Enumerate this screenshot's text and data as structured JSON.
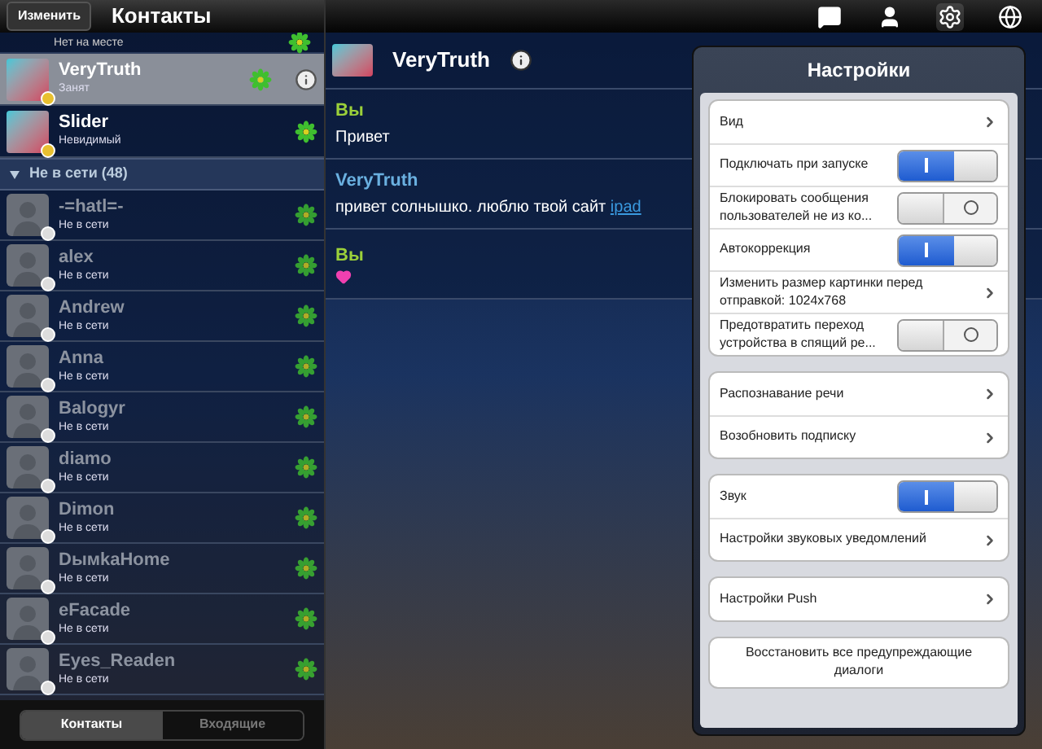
{
  "top_bar": {
    "edit_button": "Изменить",
    "title": "Контакты"
  },
  "contacts": [
    {
      "kind": "partial",
      "status": "Нет на месте"
    },
    {
      "kind": "contact",
      "name": "VeryTruth",
      "status": "Занят",
      "online": true,
      "selected": true
    },
    {
      "kind": "contact",
      "name": "Slider",
      "status": "Невидимый",
      "online": true,
      "selected": false
    },
    {
      "kind": "group",
      "label": "Не в сети (48)",
      "expanded": true
    },
    {
      "kind": "contact",
      "name": "-=hatl=-",
      "status": "Не в сети",
      "online": false,
      "selected": false
    },
    {
      "kind": "contact",
      "name": "alex",
      "status": "Не в сети",
      "online": false,
      "selected": false
    },
    {
      "kind": "contact",
      "name": "Andrew",
      "status": "Не в сети",
      "online": false,
      "selected": false
    },
    {
      "kind": "contact",
      "name": "Anna",
      "status": "Не в сети",
      "online": false,
      "selected": false
    },
    {
      "kind": "contact",
      "name": "Balogyr",
      "status": "Не в сети",
      "online": false,
      "selected": false
    },
    {
      "kind": "contact",
      "name": "diamo",
      "status": "Не в сети",
      "online": false,
      "selected": false
    },
    {
      "kind": "contact",
      "name": "Dimon",
      "status": "Не в сети",
      "online": false,
      "selected": false
    },
    {
      "kind": "contact",
      "name": "DымkaHome",
      "status": "Не в сети",
      "online": false,
      "selected": false
    },
    {
      "kind": "contact",
      "name": "eFacade",
      "status": "Не в сети",
      "online": false,
      "selected": false
    },
    {
      "kind": "contact",
      "name": "Eyes_Readen",
      "status": "Не в сети",
      "online": false,
      "selected": false
    }
  ],
  "bottom_tabs": [
    {
      "label": "Контакты",
      "selected": true
    },
    {
      "label": "Входящие",
      "selected": false
    }
  ],
  "toolbar_icons": [
    {
      "kind": "chat",
      "selected": false
    },
    {
      "kind": "person",
      "selected": false
    },
    {
      "kind": "settings",
      "selected": true
    },
    {
      "kind": "globe",
      "selected": false
    }
  ],
  "chat": {
    "name": "VeryTruth",
    "messages": [
      {
        "sender": "Вы",
        "mine": true,
        "kind": "text",
        "text": "Привет"
      },
      {
        "sender": "VeryTruth",
        "mine": false,
        "kind": "text",
        "text": "привет солнышко. люблю твой сайт",
        "link": "ipad"
      },
      {
        "sender": "Вы",
        "mine": true,
        "kind": "heart"
      }
    ]
  },
  "settings": {
    "title": "Настройки",
    "groups": [
      [
        {
          "kind": "link",
          "label": "Вид"
        },
        {
          "kind": "toggle",
          "label": "Подключать при запуске",
          "on": true
        },
        {
          "kind": "toggle",
          "label": "Блокировать сообщения пользователей не из ко...",
          "on": false
        },
        {
          "kind": "toggle",
          "label": "Автокоррекция",
          "on": true
        },
        {
          "kind": "link",
          "label": "Изменить размер картинки перед отправкой: 1024x768"
        },
        {
          "kind": "toggle",
          "label": "Предотвратить переход устройства в спящий ре...",
          "on": false
        }
      ],
      [
        {
          "kind": "link",
          "label": "Распознавание речи"
        },
        {
          "kind": "link",
          "label": "Возобновить подписку"
        }
      ],
      [
        {
          "kind": "toggle",
          "label": "Звук",
          "on": true
        },
        {
          "kind": "link",
          "label": "Настройки звуковых уведомлений"
        }
      ],
      [
        {
          "kind": "link",
          "label": "Настройки Push"
        }
      ]
    ],
    "restore_button": "Восстановить все предупреждающие диалоги"
  }
}
